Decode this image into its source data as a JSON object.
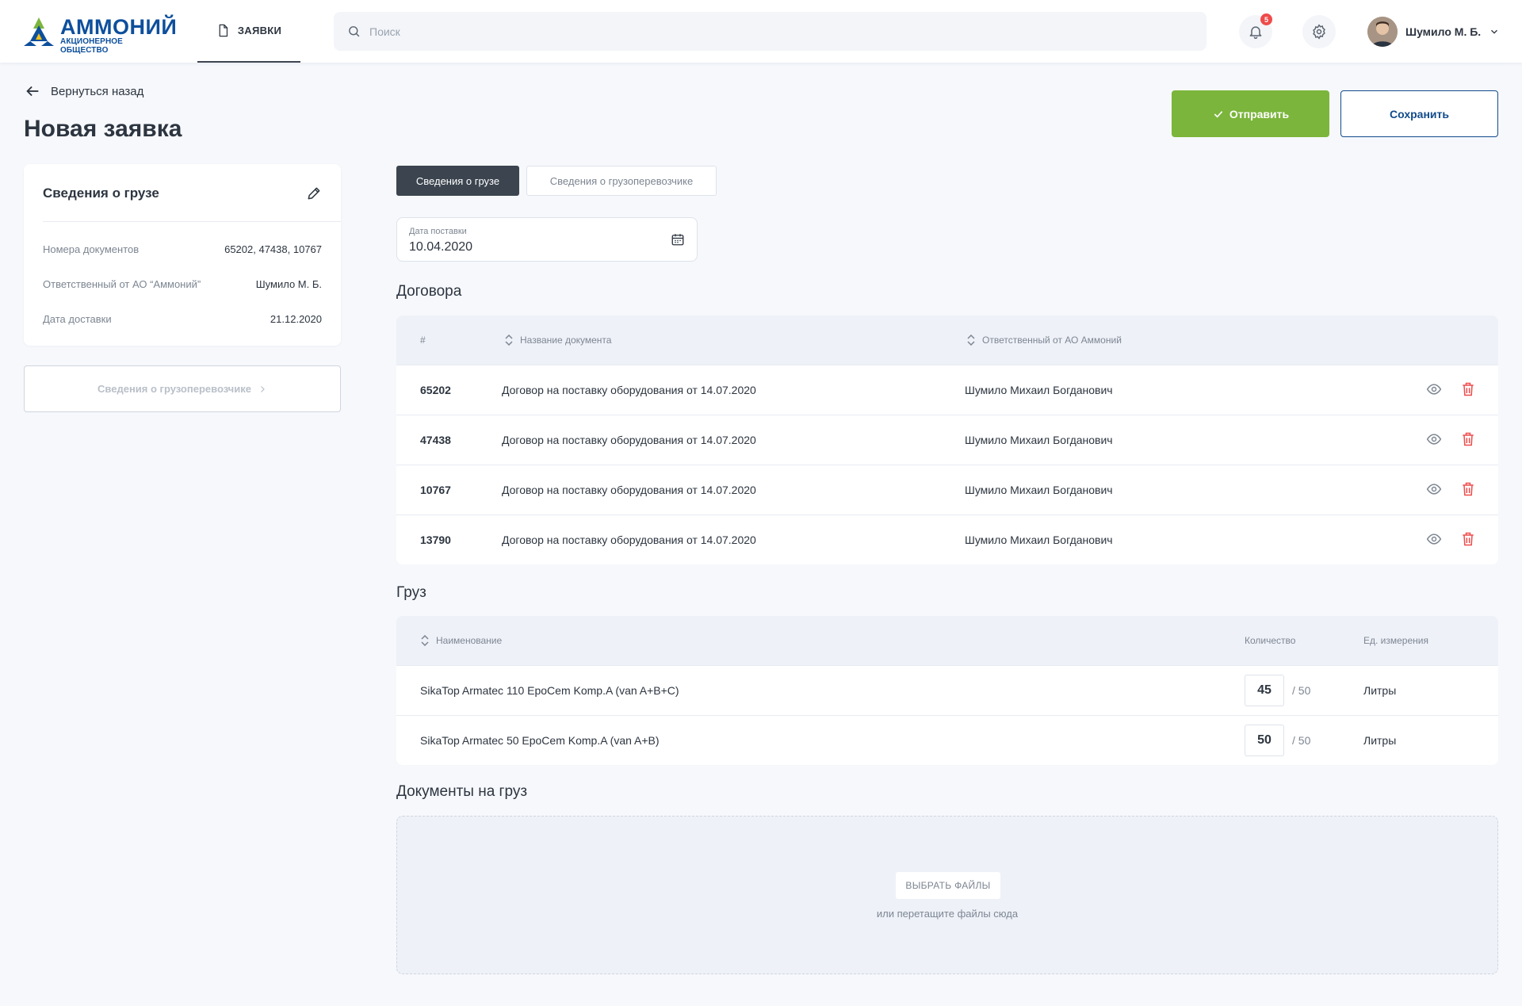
{
  "header": {
    "logo_title": "АММОНИЙ",
    "logo_subtitle": "АКЦИОНЕРНОЕ ОБЩЕСТВО",
    "nav_tab": "Заявки",
    "search_placeholder": "Поиск",
    "notifications_count": "5",
    "user_name": "Шумило М. Б."
  },
  "page": {
    "back_label": "Вернуться назад",
    "title": "Новая заявка",
    "send_label": "Отправить",
    "save_label": "Сохранить"
  },
  "summary_card": {
    "title": "Сведения о грузе",
    "rows": [
      {
        "label": "Номера документов",
        "value": "65202, 47438, 10767"
      },
      {
        "label": "Ответственный от АО “Аммоний”",
        "value": "Шумило М. Б."
      },
      {
        "label": "Дата доставки",
        "value": "21.12.2020"
      }
    ],
    "carrier_button": "Сведения о грузоперевозчике"
  },
  "tabs": [
    {
      "label": "Сведения о грузе",
      "active": true
    },
    {
      "label": "Сведения о грузоперевозчике",
      "active": false
    }
  ],
  "date_field": {
    "label": "Дата поставки",
    "value": "10.04.2020"
  },
  "contracts": {
    "title": "Договора",
    "columns": [
      "#",
      "Название документа",
      "Ответственный от АО Аммоний"
    ],
    "rows": [
      {
        "num": "65202",
        "name": "Договор на поставку оборудования от 14.07.2020",
        "responsible": "Шумило Михаил Богданович"
      },
      {
        "num": "47438",
        "name": "Договор на поставку оборудования от 14.07.2020",
        "responsible": "Шумило Михаил Богданович"
      },
      {
        "num": "10767",
        "name": "Договор на поставку оборудования от 14.07.2020",
        "responsible": "Шумило Михаил Богданович"
      },
      {
        "num": "13790",
        "name": "Договор на поставку оборудования от 14.07.2020",
        "responsible": "Шумило Михаил Богданович"
      }
    ]
  },
  "cargo": {
    "title": "Груз",
    "columns": [
      "Наименование",
      "Количество",
      "Ед. измерения"
    ],
    "rows": [
      {
        "name": "SikaTop Armatec 110 EpoCem Komp.A (van A+B+C)",
        "qty": "45",
        "max": "/ 50",
        "unit": "Литры"
      },
      {
        "name": "SikaTop Armatec 50 EpoCem Komp.A (van A+B)",
        "qty": "50",
        "max": "/ 50",
        "unit": "Литры"
      }
    ]
  },
  "documents": {
    "title": "Документы на груз",
    "choose_label": "ВЫБРАТЬ ФАЙЛЫ",
    "hint": "или перетащите файлы сюда"
  },
  "colors": {
    "accent_green": "#7bb53b",
    "brand_blue": "#0d4f9c",
    "danger_red": "#ef4b4b",
    "dark_tab": "#3b444f"
  }
}
